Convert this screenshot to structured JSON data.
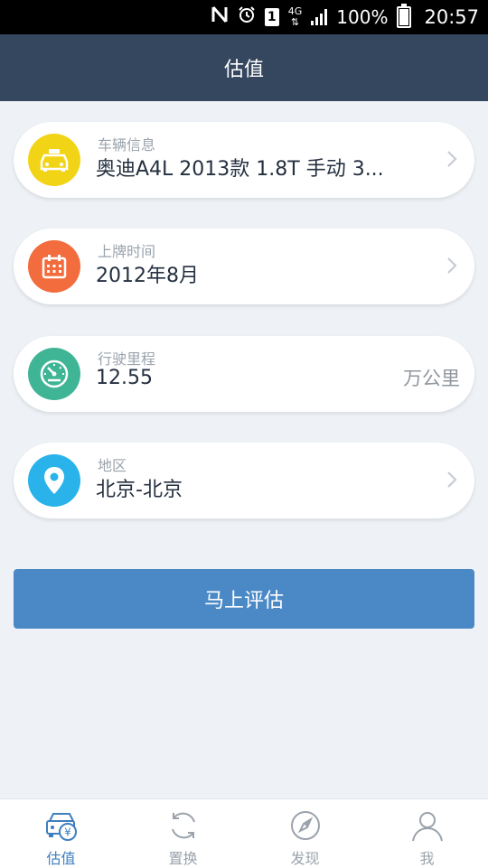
{
  "status_bar": {
    "icons": [
      "nfc-icon",
      "alarm-icon",
      "sim-icon",
      "network-4g-icon",
      "signal-icon",
      "battery-icon"
    ],
    "network": "4G",
    "sim": "1",
    "battery": "100%",
    "time": "20:57"
  },
  "header": {
    "title": "估值"
  },
  "fields": [
    {
      "label": "车辆信息",
      "value": "奥迪A4L 2013款 1.8T 手动 3...",
      "icon": "car-icon",
      "color": "#f2d416",
      "has_chevron": true
    },
    {
      "label": "上牌时间",
      "value": "2012年8月",
      "icon": "calendar-icon",
      "color": "#f26c3d",
      "has_chevron": true
    },
    {
      "label": "行驶里程",
      "value": "12.55",
      "unit": "万公里",
      "icon": "speedometer-icon",
      "color": "#3fb596",
      "has_chevron": false
    },
    {
      "label": "地区",
      "value": "北京-北京",
      "icon": "location-pin-icon",
      "color": "#29b3ea",
      "has_chevron": true
    }
  ],
  "action": {
    "label": "马上评估"
  },
  "tabs": [
    {
      "label": "估值",
      "icon": "car-price-icon",
      "active": true
    },
    {
      "label": "置换",
      "icon": "exchange-icon",
      "active": false
    },
    {
      "label": "发现",
      "icon": "compass-icon",
      "active": false
    },
    {
      "label": "我",
      "icon": "user-icon",
      "active": false
    }
  ],
  "colors": {
    "header_bg": "#34475f",
    "page_bg": "#eef2f6",
    "button_bg": "#4a89c6",
    "tab_active": "#3f7fbf",
    "tab_inactive": "#9aa2ab"
  }
}
